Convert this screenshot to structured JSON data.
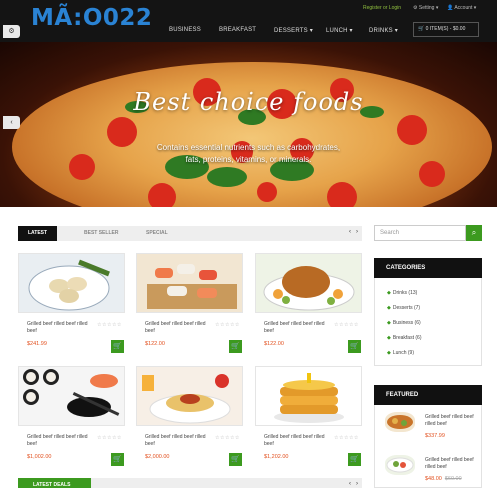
{
  "header": {
    "logo_code": "MÃ:O022",
    "register_login": "Register or Login",
    "setting": "Setting",
    "account": "Account",
    "nav": [
      "BUSINESS",
      "BREAKFAST",
      "DESSERTS",
      "LUNCH",
      "DRINKS"
    ],
    "nav_has_dropdown": [
      false,
      false,
      true,
      true,
      true
    ],
    "cart": "0 ITEM(S) - $0.00"
  },
  "hero": {
    "title": "Best choice foods",
    "subtitle_line1": "Contains essential nutrients such as carbohydrates,",
    "subtitle_line2": "fats, proteins, vitamins, or minerals."
  },
  "tabs": {
    "items": [
      "LATEST",
      "BEST SELLER",
      "SPECIAL"
    ],
    "active": "LATEST"
  },
  "products": [
    {
      "name": "Grilled beef rilled beef rilled beef",
      "price": "$241.99",
      "icon": "dumplings-plate"
    },
    {
      "name": "Grilled beef rilled beef rilled beef",
      "price": "$122.00",
      "icon": "sushi-board"
    },
    {
      "name": "Grilled beef rilled beef rilled beef",
      "price": "$122.00",
      "icon": "roast-chicken"
    },
    {
      "name": "Grilled beef rilled beef rilled beef",
      "price": "$1,002.00",
      "icon": "sushi-rolls"
    },
    {
      "name": "Grilled beef rilled beef rilled beef",
      "price": "$2,000.00",
      "icon": "spaghetti"
    },
    {
      "name": "Grilled beef rilled beef rilled beef",
      "price": "$1,202.00",
      "icon": "pancakes"
    }
  ],
  "rating_stars": "☆☆☆☆☆",
  "latest_deals": "LATEST DEALS",
  "sidebar": {
    "search_placeholder": "Search",
    "categories_title": "CATEGORIES",
    "categories": [
      "Drinks (13)",
      "Desserts (7)",
      "Business (6)",
      "Breakfast (6)",
      "Lunch (9)"
    ],
    "featured_title": "FEATURED",
    "featured": [
      {
        "name": "Grilled beef rilled beef rilled beef",
        "price": "$337.99",
        "old_price": ""
      },
      {
        "name": "Grilled beef rilled beef rilled beef",
        "price": "$48.00",
        "old_price": "$60.00"
      }
    ]
  },
  "colors": {
    "accent": "#3c9a1f",
    "price": "#e2501f",
    "header_bg": "#141414",
    "logo": "#2a83d4"
  }
}
